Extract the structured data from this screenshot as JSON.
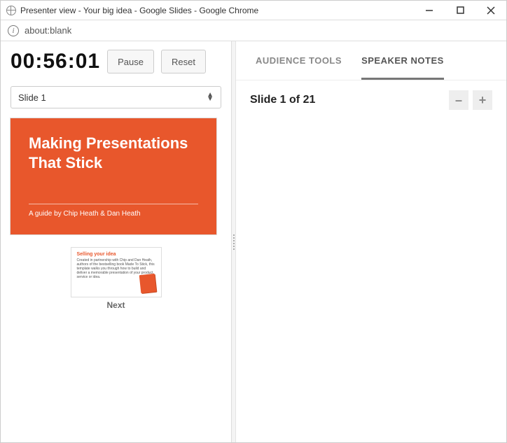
{
  "window": {
    "title": "Presenter view - Your big idea - Google Slides - Google Chrome"
  },
  "url": "about:blank",
  "timer": {
    "elapsed": "00:56:01",
    "pause_label": "Pause",
    "reset_label": "Reset"
  },
  "selector": {
    "current_label": "Slide 1"
  },
  "current_slide": {
    "title": "Making Presentations That Stick",
    "subtitle": "A guide by Chip Heath & Dan Heath"
  },
  "next_slide": {
    "heading": "Selling your idea",
    "body": "Created in partnership with Chip and Dan Heath, authors of the bestselling book Made To Stick, this template walks you through how to build and deliver a memorable presentation of your product, service or idea.",
    "label": "Next"
  },
  "tabs": {
    "audience": "AUDIENCE TOOLS",
    "speaker": "SPEAKER NOTES"
  },
  "notes": {
    "header": "Slide 1 of 21",
    "minus": "–",
    "plus": "+"
  }
}
